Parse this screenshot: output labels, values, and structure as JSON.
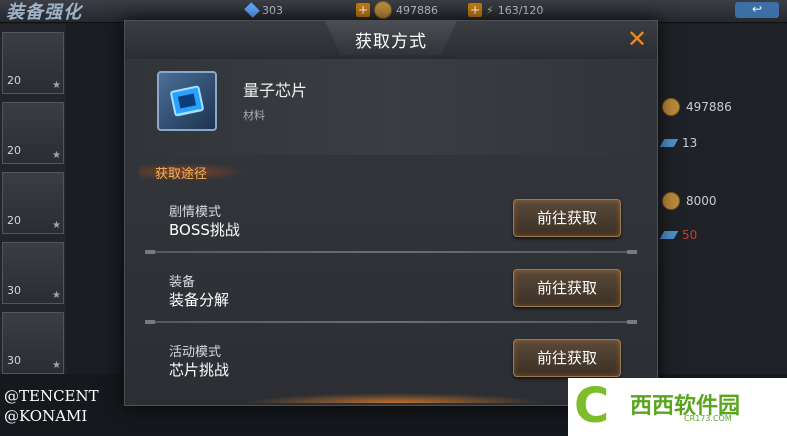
{
  "background": {
    "title": "装备强化",
    "resources": [
      {
        "icon": "diamond-icon",
        "value": "303"
      },
      {
        "icon": "coin-icon",
        "value": "497886"
      },
      {
        "icon": "energy-icon",
        "value": "163/120"
      }
    ],
    "slots": [
      {
        "level": "20"
      },
      {
        "level": "20"
      },
      {
        "level": "20"
      },
      {
        "level": "30"
      },
      {
        "level": "30"
      }
    ],
    "stats": [
      "497886",
      "13",
      "8000",
      "50"
    ]
  },
  "dialog": {
    "title": "获取方式",
    "close_label": "✕",
    "item": {
      "name": "量子芯片",
      "type": "材料",
      "icon": "quantum-chip-icon"
    },
    "section_label": "获取途径",
    "routes": [
      {
        "category": "剧情模式",
        "name": "BOSS挑战",
        "button": "前往获取"
      },
      {
        "category": "装备",
        "name": "装备分解",
        "button": "前往获取"
      },
      {
        "category": "活动模式",
        "name": "芯片挑战",
        "button": "前往获取"
      }
    ]
  },
  "watermark": {
    "copyright_line1": "@TENCENT",
    "copyright_line2": "@KONAMI",
    "site_logo": "西西软件园",
    "site_url": "CR173.COM"
  },
  "colors": {
    "accent_orange": "#f08a1c",
    "section_text": "#f2b25a"
  }
}
